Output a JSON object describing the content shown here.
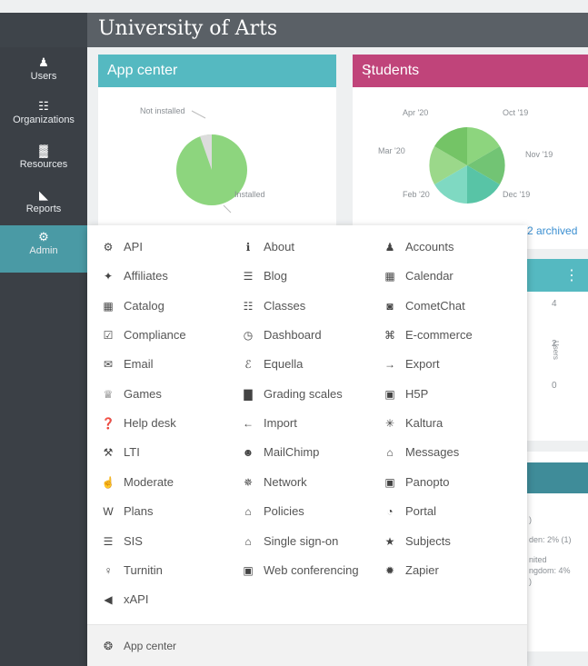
{
  "app_title": "University of Arts",
  "sidebar": [
    {
      "label": "Users",
      "icon": "user-icon",
      "glyph": "♟"
    },
    {
      "label": "Organizations",
      "icon": "organizations-icon",
      "glyph": "☷"
    },
    {
      "label": "Resources",
      "icon": "resources-icon",
      "glyph": "▓"
    },
    {
      "label": "Reports",
      "icon": "reports-icon",
      "glyph": "◣"
    },
    {
      "label": "Admin",
      "icon": "gear-icon",
      "glyph": "⚙"
    }
  ],
  "app_center": {
    "title": "App center",
    "header_color": "#55b9c1",
    "legend_not_installed": "Not installed",
    "legend_installed": "Installed"
  },
  "students": {
    "title": "Students",
    "header_color": "#c0447a",
    "labels": [
      "Apr '20",
      "Oct '19",
      "Mar '20",
      "Nov '19",
      "Feb '20",
      "Dec '19"
    ],
    "archived": "2 archived"
  },
  "background_fragments": {
    "tick_4": "4",
    "tick_2": "2",
    "tick_0": "0",
    "axis_rot": "Users",
    "frag_1": ")",
    "frag_2": "den: 2% (1)",
    "frag_3": "nited",
    "frag_4": "ngdom: 4%",
    "frag_5": ")"
  },
  "admin_menu": {
    "columns": [
      [
        {
          "label": "API",
          "icon": "api-icon",
          "glyph": "⚙"
        },
        {
          "label": "Affiliates",
          "icon": "affiliates-icon",
          "glyph": "✦"
        },
        {
          "label": "Catalog",
          "icon": "catalog-icon",
          "glyph": "▦"
        },
        {
          "label": "Compliance",
          "icon": "compliance-icon",
          "glyph": "☑"
        },
        {
          "label": "Email",
          "icon": "email-icon",
          "glyph": "✉"
        },
        {
          "label": "Games",
          "icon": "trophy-icon",
          "glyph": "♕"
        },
        {
          "label": "Help desk",
          "icon": "help-icon",
          "glyph": "❓"
        },
        {
          "label": "LTI",
          "icon": "wrench-icon",
          "glyph": "⚒"
        },
        {
          "label": "Moderate",
          "icon": "thumbs-up-icon",
          "glyph": "☝"
        },
        {
          "label": "Plans",
          "icon": "plans-icon",
          "glyph": "W"
        },
        {
          "label": "SIS",
          "icon": "database-icon",
          "glyph": "☰"
        },
        {
          "label": "Turnitin",
          "icon": "turnitin-icon",
          "glyph": "♀"
        },
        {
          "label": "xAPI",
          "icon": "xapi-icon",
          "glyph": "◀"
        }
      ],
      [
        {
          "label": "About",
          "icon": "info-icon",
          "glyph": "ℹ"
        },
        {
          "label": "Blog",
          "icon": "blog-icon",
          "glyph": "☰"
        },
        {
          "label": "Classes",
          "icon": "classes-icon",
          "glyph": "☷"
        },
        {
          "label": "Dashboard",
          "icon": "dashboard-icon",
          "glyph": "◷"
        },
        {
          "label": "Equella",
          "icon": "equella-icon",
          "glyph": "ℰ"
        },
        {
          "label": "Grading scales",
          "icon": "grading-icon",
          "glyph": "▇"
        },
        {
          "label": "Import",
          "icon": "import-icon",
          "glyph": "←"
        },
        {
          "label": "MailChimp",
          "icon": "mailchimp-icon",
          "glyph": "☻"
        },
        {
          "label": "Network",
          "icon": "network-icon",
          "glyph": "✵"
        },
        {
          "label": "Policies",
          "icon": "lock-icon",
          "glyph": "⌂"
        },
        {
          "label": "Single sign-on",
          "icon": "sso-lock-icon",
          "glyph": "⌂"
        },
        {
          "label": "Web conferencing",
          "icon": "monitor-icon",
          "glyph": "▣"
        }
      ],
      [
        {
          "label": "Accounts",
          "icon": "accounts-icon",
          "glyph": "♟"
        },
        {
          "label": "Calendar",
          "icon": "calendar-icon",
          "glyph": "▦"
        },
        {
          "label": "CometChat",
          "icon": "cometchat-icon",
          "glyph": "◙"
        },
        {
          "label": "E-commerce",
          "icon": "cart-icon",
          "glyph": "⌘"
        },
        {
          "label": "Export",
          "icon": "export-icon",
          "glyph": "→"
        },
        {
          "label": "H5P",
          "icon": "h5p-icon",
          "glyph": "▣"
        },
        {
          "label": "Kaltura",
          "icon": "kaltura-icon",
          "glyph": "✳"
        },
        {
          "label": "Messages",
          "icon": "messages-icon",
          "glyph": "⌂"
        },
        {
          "label": "Panopto",
          "icon": "panopto-icon",
          "glyph": "▣"
        },
        {
          "label": "Portal",
          "icon": "portal-icon",
          "glyph": "◔"
        },
        {
          "label": "Subjects",
          "icon": "star-icon",
          "glyph": "★"
        },
        {
          "label": "Zapier",
          "icon": "zapier-icon",
          "glyph": "✹"
        }
      ]
    ],
    "footer_label": "App center",
    "footer_icon": "❂"
  }
}
